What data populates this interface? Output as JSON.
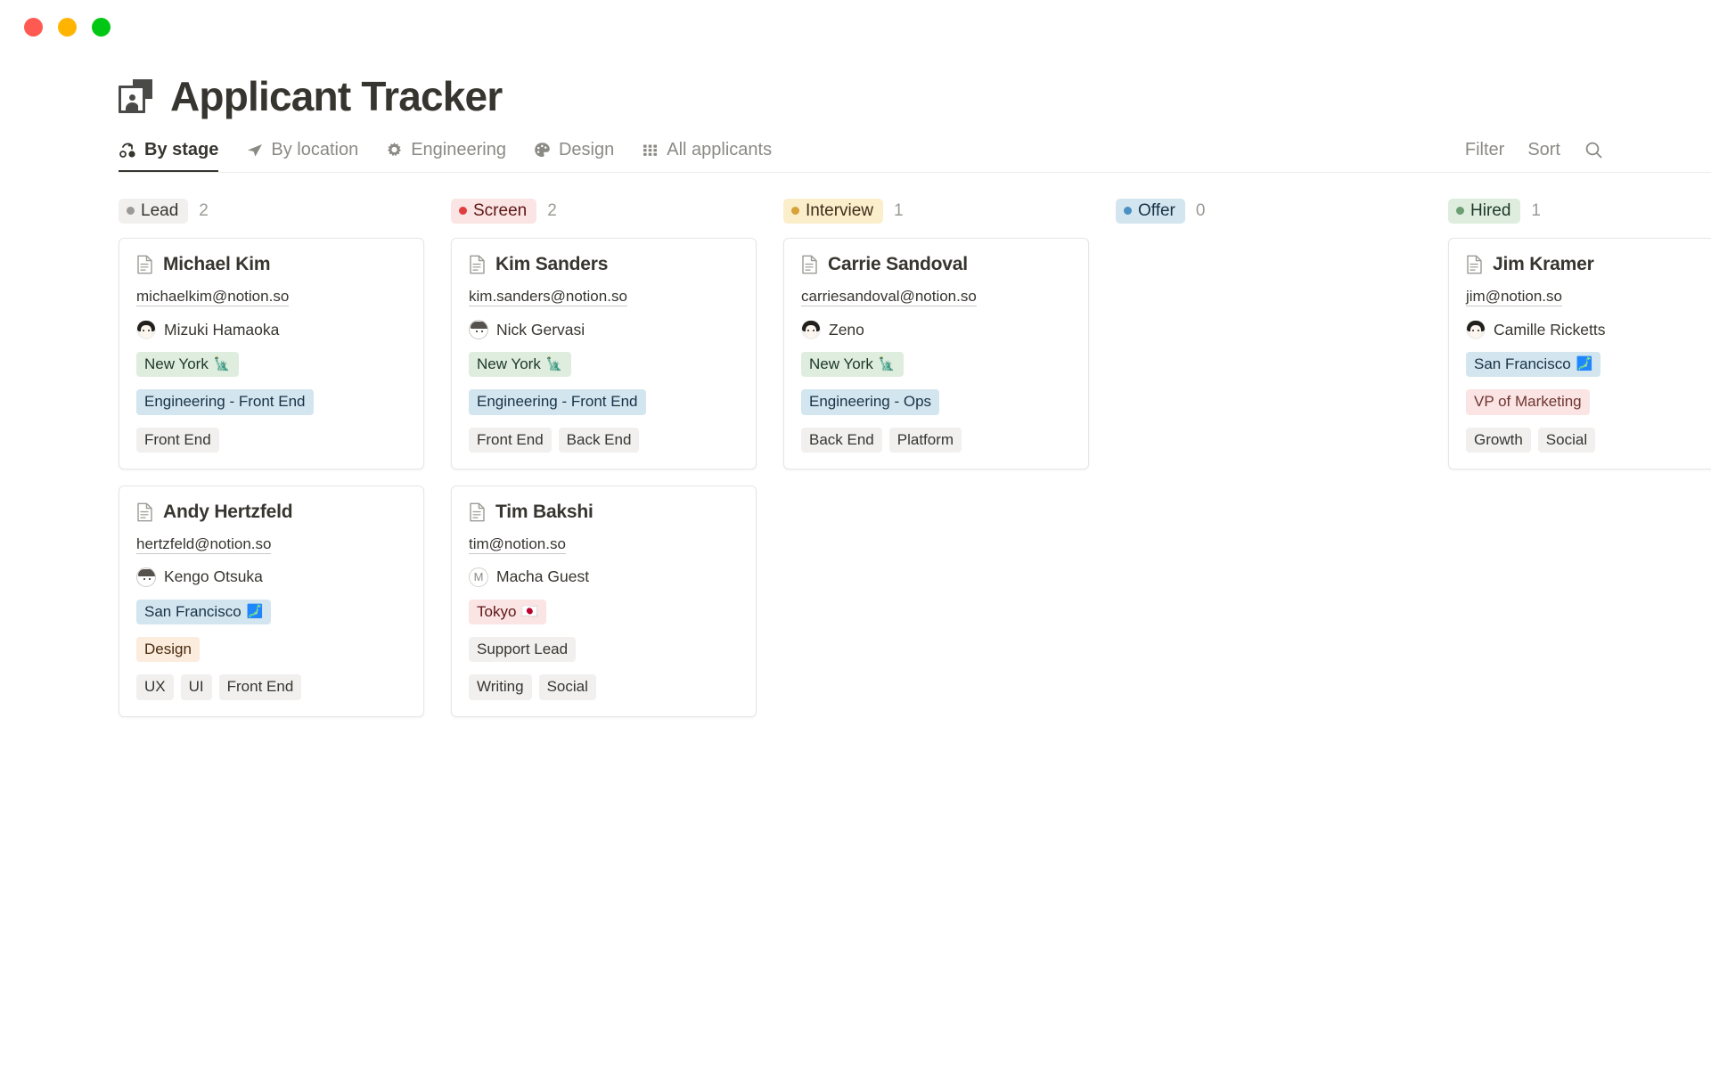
{
  "window": {
    "traffic_lights": [
      {
        "name": "close",
        "color": "#ff5a52"
      },
      {
        "name": "minimize",
        "color": "#ffb500"
      },
      {
        "name": "maximize",
        "color": "#00c713"
      }
    ]
  },
  "header": {
    "title": "Applicant Tracker",
    "icon": "applicant-card-icon"
  },
  "tabs": [
    {
      "label": "By stage",
      "icon": "workflow-icon",
      "active": true
    },
    {
      "label": "By location",
      "icon": "paper-plane-icon",
      "active": false
    },
    {
      "label": "Engineering",
      "icon": "gear-icon",
      "active": false
    },
    {
      "label": "Design",
      "icon": "palette-icon",
      "active": false
    },
    {
      "label": "All applicants",
      "icon": "grid-icon",
      "active": false
    }
  ],
  "tools": {
    "filter_label": "Filter",
    "sort_label": "Sort",
    "search_icon": "search-icon"
  },
  "board": {
    "columns": [
      {
        "stage": "Lead",
        "stage_theme": "s-gray",
        "count": "2",
        "cards": [
          {
            "name": "Michael Kim",
            "email": "michaelkim@notion.so",
            "recruiter": "Mizuki Hamaoka",
            "avatar_style": "photo",
            "avatar_letter": "",
            "location": "New York",
            "location_emoji": "🗽",
            "location_theme": "t-green",
            "role": "Engineering - Front End",
            "role_theme": "t-blue",
            "skills": [
              "Front End"
            ]
          },
          {
            "name": "Andy Hertzfeld",
            "email": "hertzfeld@notion.so",
            "recruiter": "Kengo Otsuka",
            "avatar_style": "outline",
            "avatar_letter": "",
            "location": "San Francisco",
            "location_emoji": "🗾",
            "location_theme": "t-blue",
            "role": "Design",
            "role_theme": "t-yellow",
            "skills": [
              "UX",
              "UI",
              "Front End"
            ]
          }
        ]
      },
      {
        "stage": "Screen",
        "stage_theme": "s-red",
        "count": "2",
        "cards": [
          {
            "name": "Kim Sanders",
            "email": "kim.sanders@notion.so",
            "recruiter": "Nick Gervasi",
            "avatar_style": "outline",
            "avatar_letter": "",
            "location": "New York",
            "location_emoji": "🗽",
            "location_theme": "t-green",
            "role": "Engineering - Front End",
            "role_theme": "t-blue",
            "skills": [
              "Front End",
              "Back End"
            ]
          },
          {
            "name": "Tim Bakshi",
            "email": "tim@notion.so",
            "recruiter": "Macha Guest",
            "avatar_style": "letter",
            "avatar_letter": "M",
            "location": "Tokyo",
            "location_emoji": "🇯🇵",
            "location_theme": "t-red",
            "role": "Support Lead",
            "role_theme": "t-gray",
            "skills": [
              "Writing",
              "Social"
            ]
          }
        ]
      },
      {
        "stage": "Interview",
        "stage_theme": "s-yellow",
        "count": "1",
        "cards": [
          {
            "name": "Carrie Sandoval",
            "email": "carriesandoval@notion.so",
            "recruiter": "Zeno",
            "avatar_style": "photo",
            "avatar_letter": "",
            "location": "New York",
            "location_emoji": "🗽",
            "location_theme": "t-green",
            "role": "Engineering - Ops",
            "role_theme": "t-blue",
            "skills": [
              "Back End",
              "Platform"
            ]
          }
        ]
      },
      {
        "stage": "Offer",
        "stage_theme": "s-blue",
        "count": "0",
        "cards": []
      },
      {
        "stage": "Hired",
        "stage_theme": "s-green",
        "count": "1",
        "cards": [
          {
            "name": "Jim Kramer",
            "email": "jim@notion.so",
            "recruiter": "Camille Ricketts",
            "avatar_style": "photo",
            "avatar_letter": "",
            "location": "San Francisco",
            "location_emoji": "🗾",
            "location_theme": "t-blue",
            "role": "VP of Marketing",
            "role_theme": "t-pink",
            "skills": [
              "Growth",
              "Social"
            ]
          }
        ]
      }
    ]
  }
}
